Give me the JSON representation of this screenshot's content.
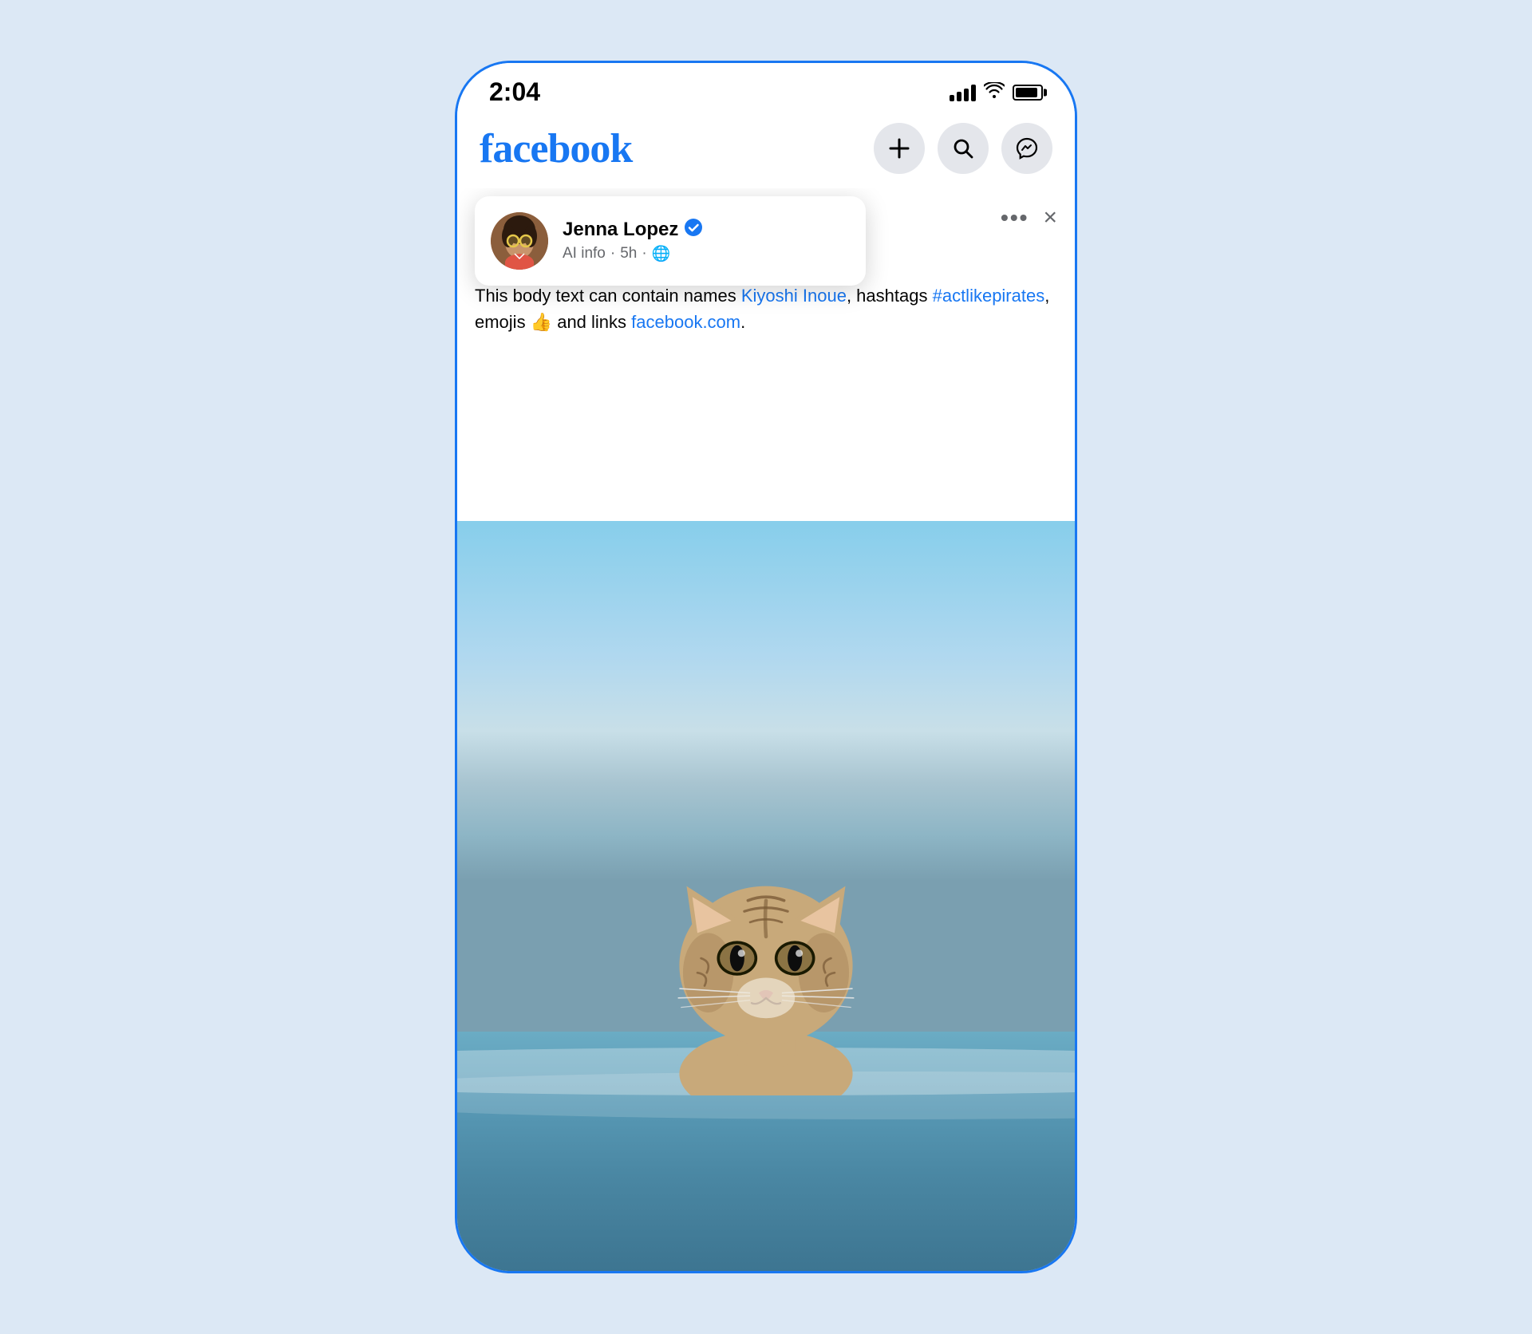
{
  "device": {
    "time": "2:04",
    "signal_label": "signal",
    "wifi_label": "wifi",
    "battery_label": "battery"
  },
  "app": {
    "name": "facebook",
    "add_button_label": "+",
    "search_button_label": "🔍",
    "messenger_button_label": "💬"
  },
  "post": {
    "author_name": "Jenna Lopez",
    "verified": true,
    "ai_info_label": "AI info",
    "time": "5h",
    "privacy_icon": "🌐",
    "body_prefix": "This body text can contain names ",
    "tagged_user": "Kiyoshi Inoue",
    "body_middle": ", hashtags ",
    "hashtag": "#actlikepirates",
    "body_emoji_prefix": ", emojis ",
    "emoji": "👍",
    "body_link_prefix": " and links ",
    "link": "facebook.com",
    "body_suffix": ".",
    "more_label": "•••",
    "close_label": "×"
  },
  "avatar": {
    "emoji": "👩"
  }
}
